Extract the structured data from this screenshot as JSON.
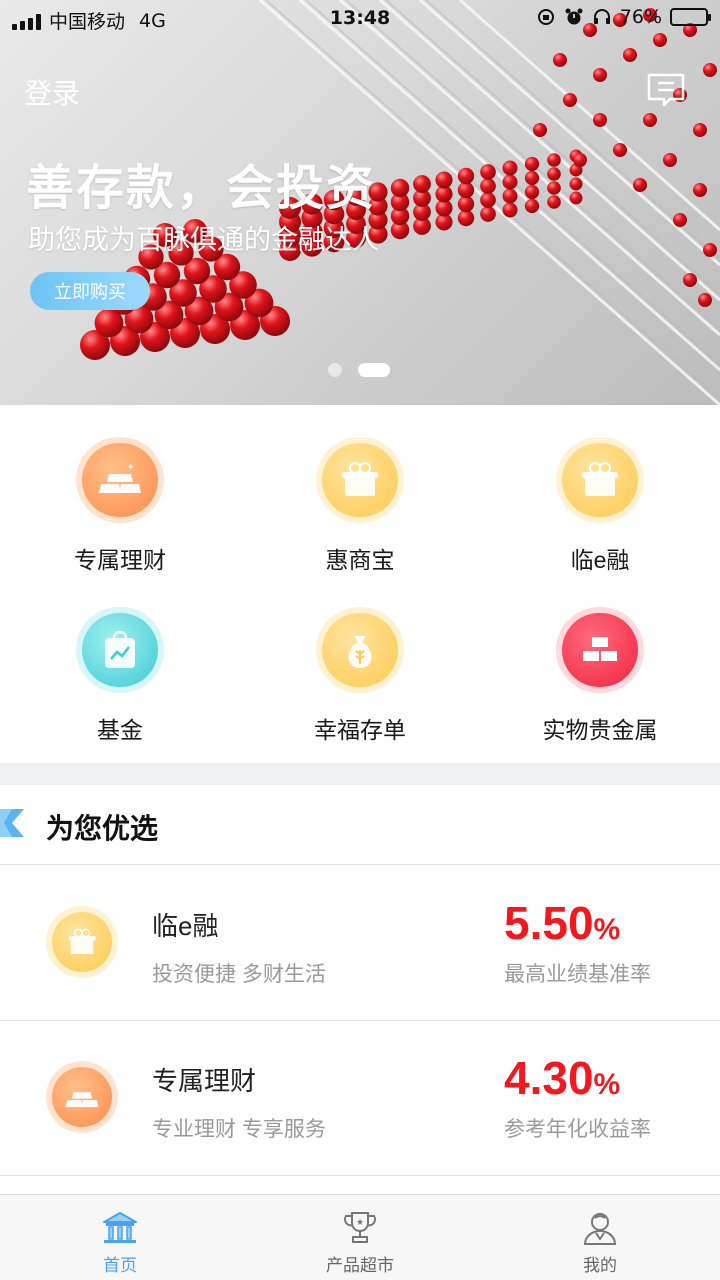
{
  "status_bar": {
    "carrier": "中国移动",
    "network": "4G",
    "time": "13:48",
    "battery_percent": "76%",
    "battery_level": 0.76,
    "icons": [
      "signal-icon",
      "rotation-lock-icon",
      "alarm-icon",
      "headphones-icon",
      "battery-icon"
    ]
  },
  "header": {
    "login_label": "登录",
    "message_icon": "message-icon"
  },
  "banner": {
    "title": "善存款，会投资",
    "subtitle": "助您成为百脉俱通的金融达人",
    "cta_label": "立即购买",
    "slide_count": 2,
    "active_slide": 2
  },
  "menu": {
    "items": [
      {
        "label": "专属理财",
        "icon": "gold-bars-icon",
        "color": "#ff8a4c"
      },
      {
        "label": "惠商宝",
        "icon": "gift-box-icon",
        "color": "#ffc94e"
      },
      {
        "label": "临e融",
        "icon": "gift-box-icon",
        "color": "#ffc94e"
      },
      {
        "label": "基金",
        "icon": "shopping-bag-chart-icon",
        "color": "#3fcad6"
      },
      {
        "label": "幸福存单",
        "icon": "money-bag-icon",
        "color": "#ffc94e"
      },
      {
        "label": "实物贵金属",
        "icon": "bricks-icon",
        "color": "#f2233f"
      }
    ]
  },
  "recommend": {
    "title": "为您优选",
    "products": [
      {
        "name": "临e融",
        "desc": "投资便捷 多财生活",
        "rate": "5.50",
        "unit": "%",
        "rate_label": "最高业绩基准率",
        "icon": "gift-box-icon"
      },
      {
        "name": "专属理财",
        "desc": "专业理财 专享服务",
        "rate": "4.30",
        "unit": "%",
        "rate_label": "参考年化收益率",
        "icon": "gold-bars-icon"
      }
    ]
  },
  "tabbar": {
    "tabs": [
      {
        "label": "首页",
        "icon": "bank-icon",
        "active": true
      },
      {
        "label": "产品超市",
        "icon": "trophy-icon",
        "active": false
      },
      {
        "label": "我的",
        "icon": "user-icon",
        "active": false
      }
    ]
  },
  "colors": {
    "accent_blue": "#4aa3e8",
    "rate_red": "#f2181f",
    "separator": "#eff0f4"
  }
}
